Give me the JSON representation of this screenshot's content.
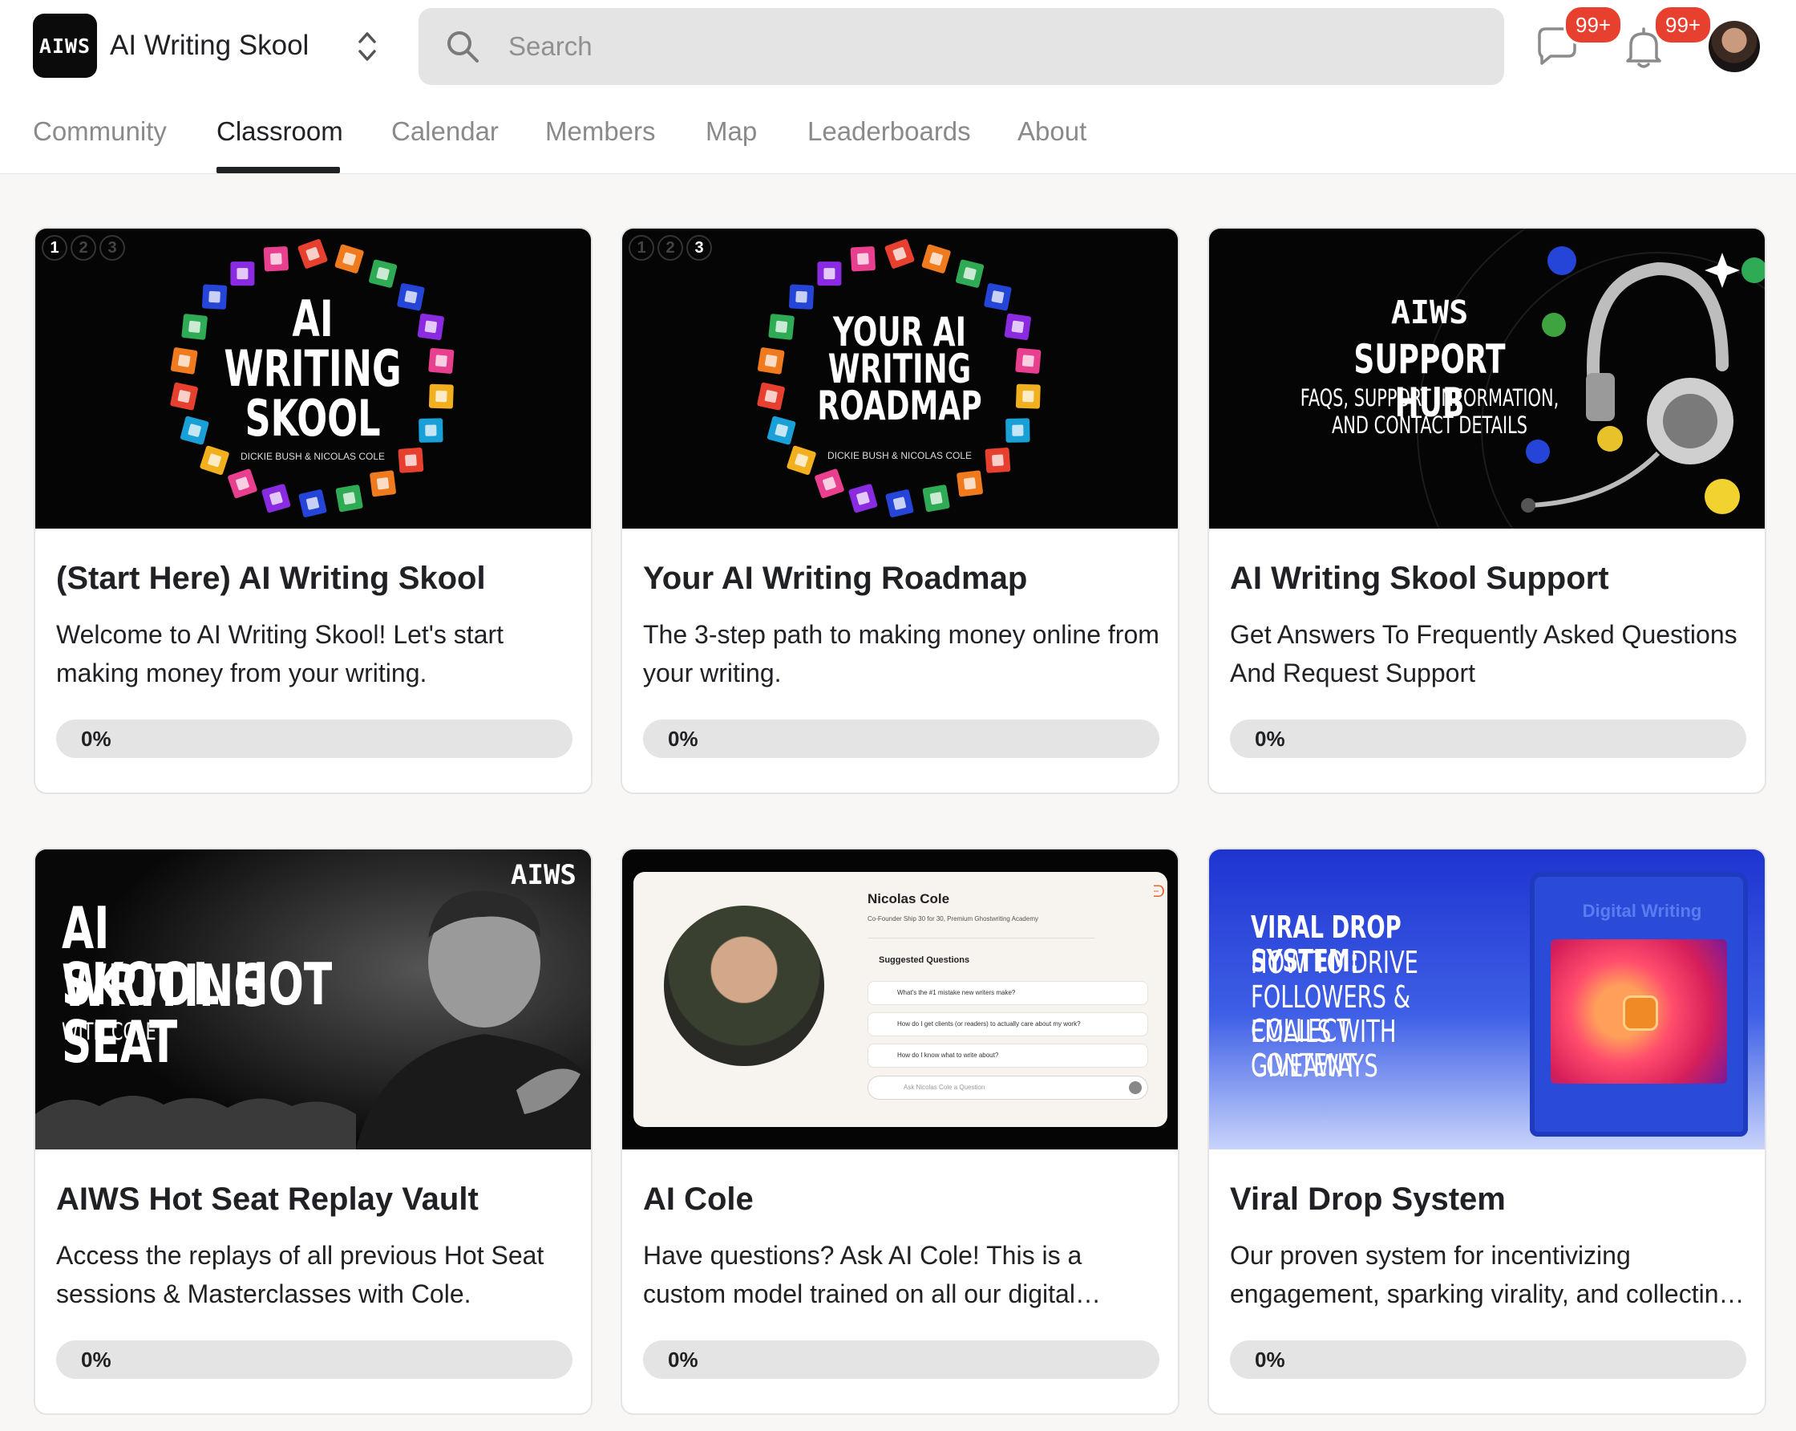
{
  "group": {
    "logo_text": "AIWS",
    "name": "AI Writing Skool"
  },
  "search": {
    "placeholder": "Search",
    "value": ""
  },
  "notifications": {
    "chat_count": "99+",
    "bell_count": "99+"
  },
  "tabs": [
    {
      "label": "Community"
    },
    {
      "label": "Classroom"
    },
    {
      "label": "Calendar"
    },
    {
      "label": "Members"
    },
    {
      "label": "Map"
    },
    {
      "label": "Leaderboards"
    },
    {
      "label": "About"
    }
  ],
  "active_tab": "Classroom",
  "courses": [
    {
      "title": "(Start Here) AI Writing Skool",
      "description": "Welcome to AI Writing Skool! Let's start making money from your writing.",
      "progress_label": "0%",
      "progress": 0,
      "thumb": {
        "steps": [
          "1",
          "2",
          "3"
        ],
        "active_step": "1",
        "line1": "AI",
        "line2": "WRITING",
        "line3": "SKOOL",
        "byline": "DICKIE BUSH & NICOLAS COLE"
      }
    },
    {
      "title": "Your AI Writing Roadmap",
      "description": "The 3-step path to making money online from your writing.",
      "progress_label": "0%",
      "progress": 0,
      "thumb": {
        "steps": [
          "1",
          "2",
          "3"
        ],
        "active_step": "3",
        "line1": "YOUR AI",
        "line2": "WRITING",
        "line3": "ROADMAP",
        "byline": "DICKIE BUSH & NICOLAS COLE"
      }
    },
    {
      "title": "AI Writing Skool Support",
      "description": "Get Answers To Frequently Asked Questions And Request Support",
      "progress_label": "0%",
      "progress": 0,
      "thumb": {
        "brand": "AIWS",
        "headline": "SUPPORT HUB",
        "sub1": "FAQS, SUPPORT INFORMATION,",
        "sub2": "AND CONTACT DETAILS"
      }
    },
    {
      "title": "AIWS Hot Seat Replay Vault",
      "description": "Access the replays of all previous Hot Seat sessions & Masterclasses with Cole.",
      "progress_label": "0%",
      "progress": 0,
      "thumb": {
        "brand": "AIWS",
        "line1": "AI WRITING",
        "line2": "SKOOL HOT SEAT",
        "line3": "WITH COLE"
      }
    },
    {
      "title": "AI Cole",
      "description": "Have questions? Ask AI Cole! This is a custom model trained on all our digital…",
      "progress_label": "0%",
      "progress": 0,
      "thumb": {
        "name": "Nicolas Cole",
        "subtitle": "Co-Founder Ship 30 for 30, Premium Ghostwriting Academy",
        "section": "Suggested Questions",
        "questions": [
          "What's the #1 mistake new writers make?",
          "How do I get clients (or readers) to actually care about my work?",
          "How do I know what to write about?"
        ],
        "ask_placeholder": "Ask Nicolas Cole a Question"
      }
    },
    {
      "title": "Viral Drop System",
      "description": "Our proven system for incentivizing engagement, sparking virality, and collectin…",
      "progress_label": "0%",
      "progress": 0,
      "thumb": {
        "line1": "VIRAL DROP SYSTEM:",
        "line2": "HOW TO DRIVE",
        "line3": "FOLLOWERS & COLLECT",
        "line4": "EMAILS WITH CONTENT",
        "line5": "GIVEAWAYS",
        "cartridge_label": "Digital Writing"
      }
    }
  ],
  "colors": {
    "accent": "#202124",
    "badge": "#e8402f",
    "search_bg": "#e4e4e4",
    "page_bg": "#f8f7f5",
    "viral_blue": "#2340d8"
  }
}
